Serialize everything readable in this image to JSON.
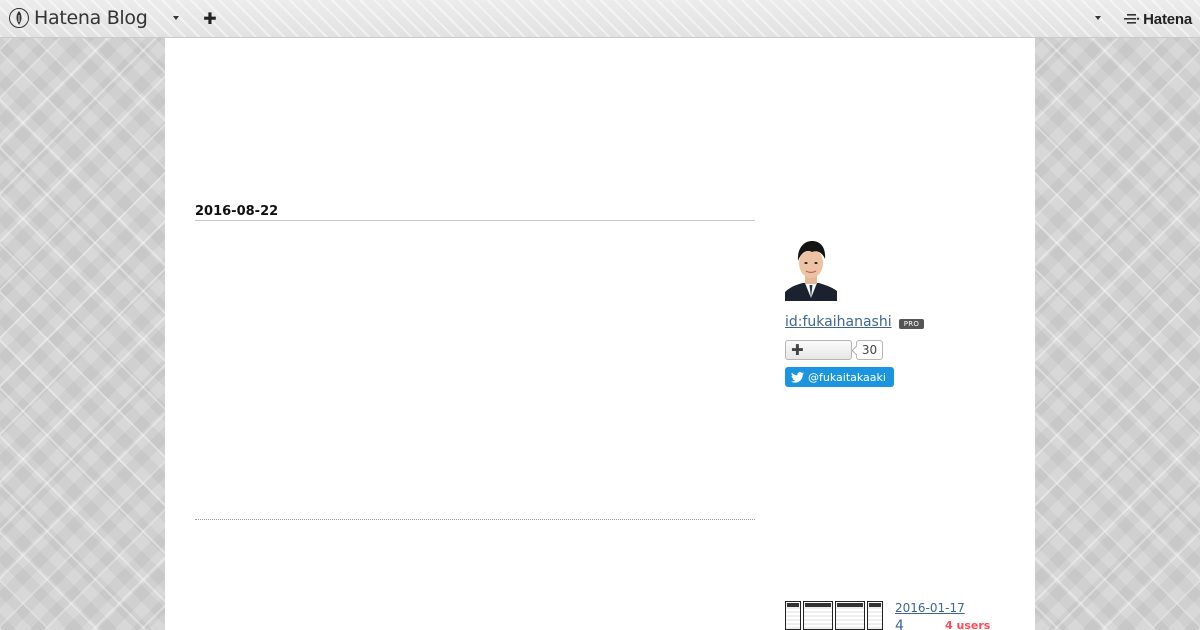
{
  "header": {
    "brand": "Hatena Blog",
    "right_brand": "Hatena"
  },
  "entry": {
    "date": "2016-08-22"
  },
  "sidebar": {
    "profile_id": "id:fukaihanashi",
    "pro_badge": "PRO",
    "subscribe_count": "30",
    "twitter_handle": "@fukaitakaaki",
    "archive": {
      "date": "2016-01-17",
      "title": "4",
      "users": "4 users"
    }
  },
  "colors": {
    "link": "#3d6791",
    "twitter": "#1b95e0",
    "bookmark_users": "#ff4b55"
  }
}
